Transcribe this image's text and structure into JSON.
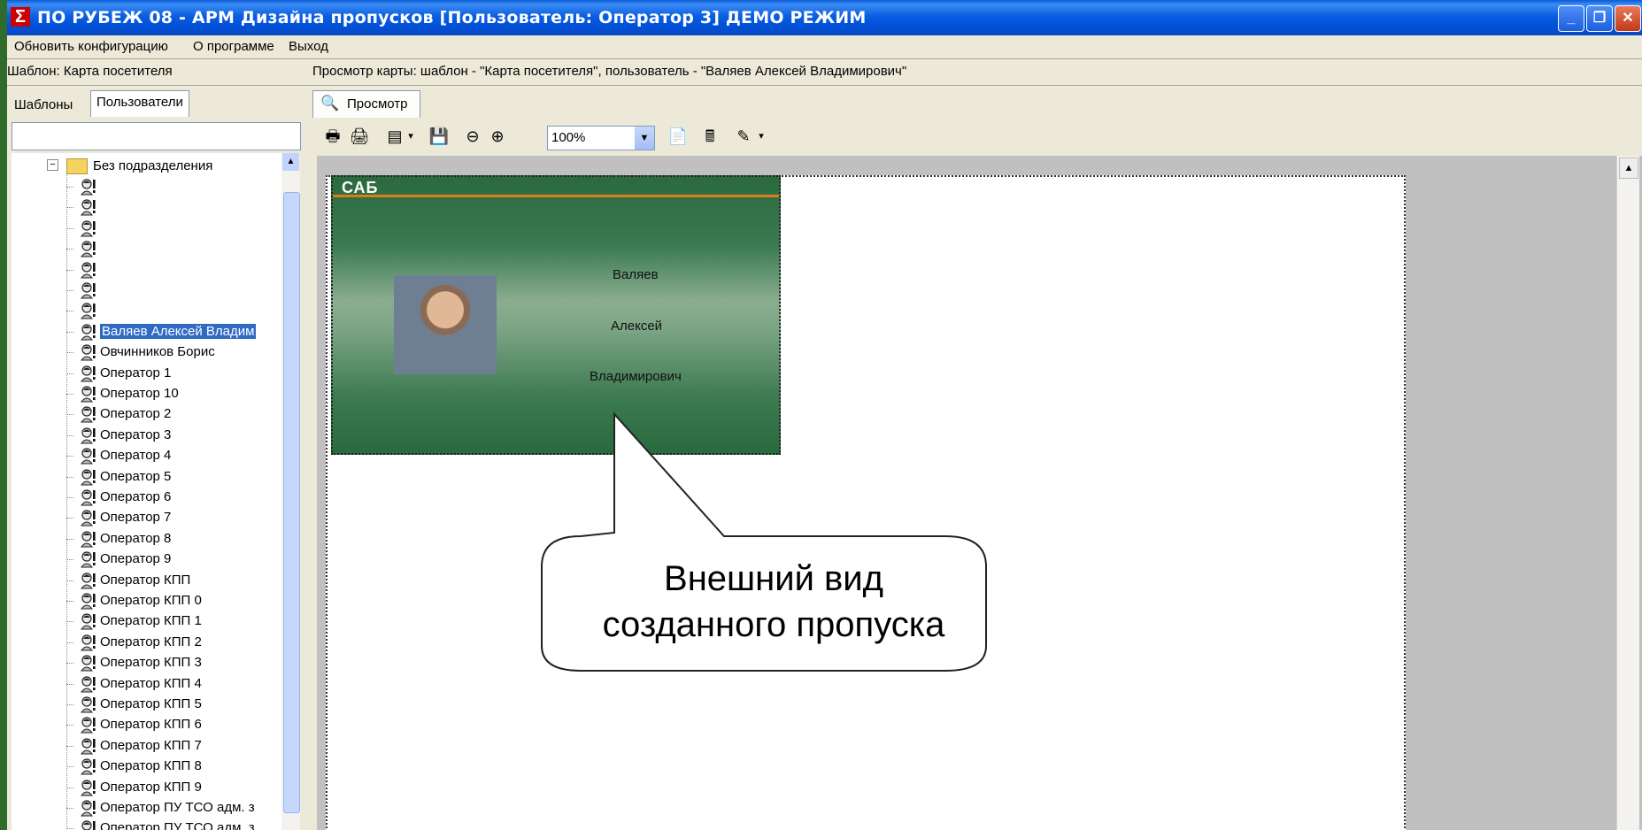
{
  "window": {
    "title": "ПО РУБЕЖ 08 - АРМ Дизайна пропусков [Пользователь: Оператор 3] ДЕМО РЕЖИМ",
    "app_icon": "sigma-icon"
  },
  "menu": {
    "items": [
      "Обновить конфигурацию",
      "О программе",
      "Выход"
    ]
  },
  "left_panel": {
    "caption": "Шаблон: Карта посетителя",
    "tabs": [
      "Шаблоны",
      "Пользователи"
    ],
    "active_tab": "Пользователи",
    "search_value": "",
    "tree": {
      "folder": "Без подразделения",
      "unnamed_users": 7,
      "users": [
        {
          "label": "Валяев Алексей Владим",
          "selected": true
        },
        {
          "label": "Овчинников Борис"
        },
        {
          "label": "Оператор 1"
        },
        {
          "label": "Оператор 10"
        },
        {
          "label": "Оператор 2"
        },
        {
          "label": "Оператор 3"
        },
        {
          "label": "Оператор 4"
        },
        {
          "label": "Оператор 5"
        },
        {
          "label": "Оператор 6"
        },
        {
          "label": "Оператор 7"
        },
        {
          "label": "Оператор 8"
        },
        {
          "label": "Оператор 9"
        },
        {
          "label": "Оператор КПП"
        },
        {
          "label": "Оператор КПП 0"
        },
        {
          "label": "Оператор КПП 1"
        },
        {
          "label": "Оператор КПП 2"
        },
        {
          "label": "Оператор КПП 3"
        },
        {
          "label": "Оператор КПП 4"
        },
        {
          "label": "Оператор КПП 5"
        },
        {
          "label": "Оператор КПП 6"
        },
        {
          "label": "Оператор КПП 7"
        },
        {
          "label": "Оператор КПП 8"
        },
        {
          "label": "Оператор КПП 9"
        },
        {
          "label": "Оператор ПУ ТСО адм. з"
        },
        {
          "label": "Оператор ПУ ТСО адм. з"
        }
      ]
    }
  },
  "right_panel": {
    "caption": "Просмотр карты: шаблон - \"Карта посетителя\", пользователь - \"Валяев Алексей Владимирович\"",
    "tab": "Просмотр",
    "zoom": "100%"
  },
  "card": {
    "logo": "САБ",
    "last_name": "Валяев",
    "first_name": "Алексей",
    "patronymic": "Владимирович"
  },
  "callout": {
    "line1": "Внешний вид",
    "line2": "созданного пропуска"
  },
  "colors": {
    "titlebar": "#0a5ad6",
    "selection": "#316ac5",
    "card_green": "#2b6a3e",
    "card_stripe": "#e07a1a",
    "desktop": "#2f6b2a"
  }
}
